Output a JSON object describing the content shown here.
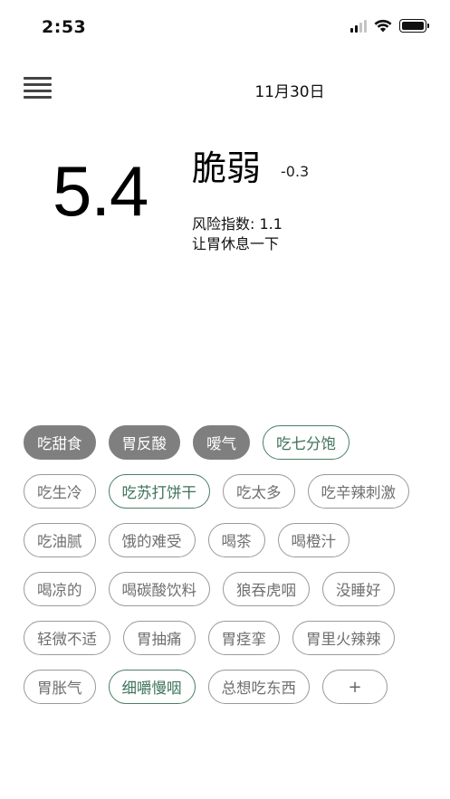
{
  "status_bar": {
    "time": "2:53",
    "icons": [
      "signal-icon",
      "wifi-icon",
      "battery-icon"
    ]
  },
  "header": {
    "menu_icon": "hamburger-menu-icon",
    "date": "11月30日"
  },
  "summary": {
    "score": "5.4",
    "status": "脆弱",
    "delta": "-0.3",
    "risk": "风险指数: 1.1",
    "advice": "让胃休息一下"
  },
  "colors": {
    "selected_tag_bg": "#7f7f7f",
    "recommended_tag": "#4a7f66",
    "default_tag_border": "#9a9a9a"
  },
  "tags": [
    {
      "label": "吃甜食",
      "state": "selected"
    },
    {
      "label": "胃反酸",
      "state": "selected"
    },
    {
      "label": "嗳气",
      "state": "selected"
    },
    {
      "label": "吃七分饱",
      "state": "recommended"
    },
    {
      "label": "吃生冷",
      "state": "default"
    },
    {
      "label": "吃苏打饼干",
      "state": "recommended"
    },
    {
      "label": "吃太多",
      "state": "default"
    },
    {
      "label": "吃辛辣刺激",
      "state": "default"
    },
    {
      "label": "吃油腻",
      "state": "default"
    },
    {
      "label": "饿的难受",
      "state": "default"
    },
    {
      "label": "喝茶",
      "state": "default"
    },
    {
      "label": "喝橙汁",
      "state": "default"
    },
    {
      "label": "喝凉的",
      "state": "default"
    },
    {
      "label": "喝碳酸饮料",
      "state": "default"
    },
    {
      "label": "狼吞虎咽",
      "state": "default"
    },
    {
      "label": "没睡好",
      "state": "default"
    },
    {
      "label": "轻微不适",
      "state": "default"
    },
    {
      "label": "胃抽痛",
      "state": "default"
    },
    {
      "label": "胃痉挛",
      "state": "default"
    },
    {
      "label": "胃里火辣辣",
      "state": "default"
    },
    {
      "label": "胃胀气",
      "state": "default"
    },
    {
      "label": "细嚼慢咽",
      "state": "recommended"
    },
    {
      "label": "总想吃东西",
      "state": "default"
    }
  ],
  "add_button": {
    "label": "+"
  }
}
